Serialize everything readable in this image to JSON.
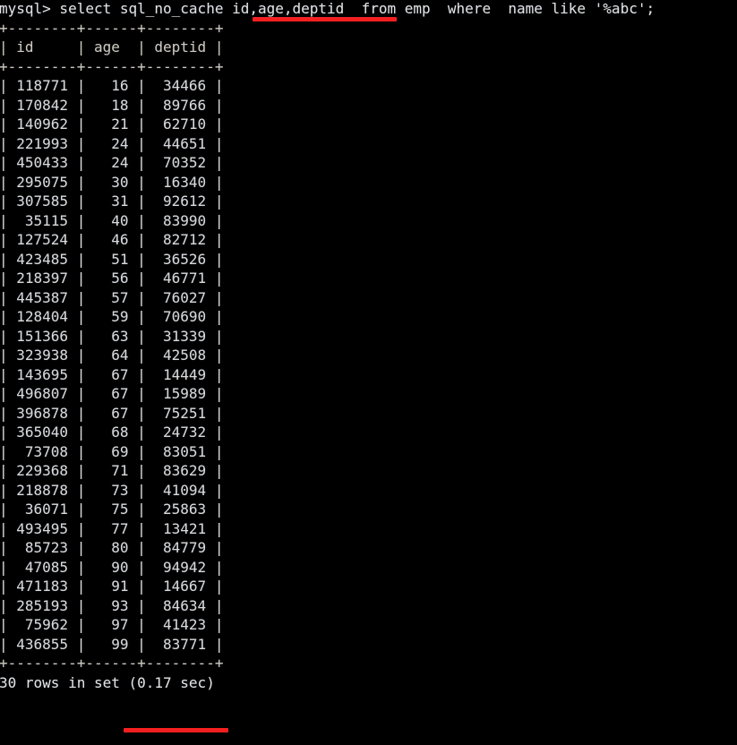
{
  "terminal": {
    "prompt": "mysql> ",
    "query": "select sql_no_cache id,age,deptid  from emp  where  name like '%abc';",
    "full_command_line": "mysql> select sql_no_cache id,age,deptid  from emp  where  name like '%abc';",
    "separator": "+--------+------+--------+",
    "header_row": "| id     | age  | deptid |",
    "footer_status": "30 rows in set (0.17 sec)",
    "columns": [
      "id",
      "age",
      "deptid"
    ],
    "row_count_label": "30 rows in set",
    "timing_label": "(0.17 sec)",
    "colors": {
      "background": "#000000",
      "text": "#d9d9d9",
      "annotation": "#f42020"
    },
    "annotations": [
      {
        "name": "columns-underline",
        "target": "id,age,deptid"
      },
      {
        "name": "timing-underline",
        "target": "(0.17 sec)"
      }
    ],
    "rows": [
      [
        "118771",
        "16",
        "34466"
      ],
      [
        "170842",
        "18",
        "89766"
      ],
      [
        "140962",
        "21",
        "62710"
      ],
      [
        "221993",
        "24",
        "44651"
      ],
      [
        "450433",
        "24",
        "70352"
      ],
      [
        "295075",
        "30",
        "16340"
      ],
      [
        "307585",
        "31",
        "92612"
      ],
      [
        "35115",
        "40",
        "83990"
      ],
      [
        "127524",
        "46",
        "82712"
      ],
      [
        "423485",
        "51",
        "36526"
      ],
      [
        "218397",
        "56",
        "46771"
      ],
      [
        "445387",
        "57",
        "76027"
      ],
      [
        "128404",
        "59",
        "70690"
      ],
      [
        "151366",
        "63",
        "31339"
      ],
      [
        "323938",
        "64",
        "42508"
      ],
      [
        "143695",
        "67",
        "14449"
      ],
      [
        "496807",
        "67",
        "15989"
      ],
      [
        "396878",
        "67",
        "75251"
      ],
      [
        "365040",
        "68",
        "24732"
      ],
      [
        "73708",
        "69",
        "83051"
      ],
      [
        "229368",
        "71",
        "83629"
      ],
      [
        "218878",
        "73",
        "41094"
      ],
      [
        "36071",
        "75",
        "25863"
      ],
      [
        "493495",
        "77",
        "13421"
      ],
      [
        "85723",
        "80",
        "84779"
      ],
      [
        "47085",
        "90",
        "94942"
      ],
      [
        "471183",
        "91",
        "14667"
      ],
      [
        "285193",
        "93",
        "84634"
      ],
      [
        "75962",
        "97",
        "41423"
      ],
      [
        "436855",
        "99",
        "83771"
      ]
    ]
  }
}
